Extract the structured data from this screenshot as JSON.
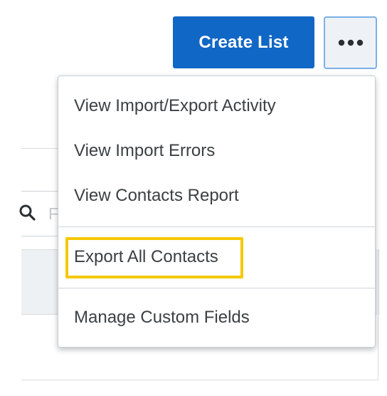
{
  "toolbar": {
    "create_list_label": "Create List",
    "more_icon": "more-horizontal-icon",
    "more_button_color": "#1167c5"
  },
  "background": {
    "search_icon": "search-icon",
    "search_placeholder_fragment": "F"
  },
  "menu": {
    "items": [
      {
        "label": "View Import/Export Activity"
      },
      {
        "label": "View Import Errors"
      },
      {
        "label": "View Contacts Report"
      },
      {
        "label": "Export All Contacts",
        "highlighted": true
      },
      {
        "label": "Manage Custom Fields"
      }
    ],
    "highlight_color": "#f5c800"
  }
}
